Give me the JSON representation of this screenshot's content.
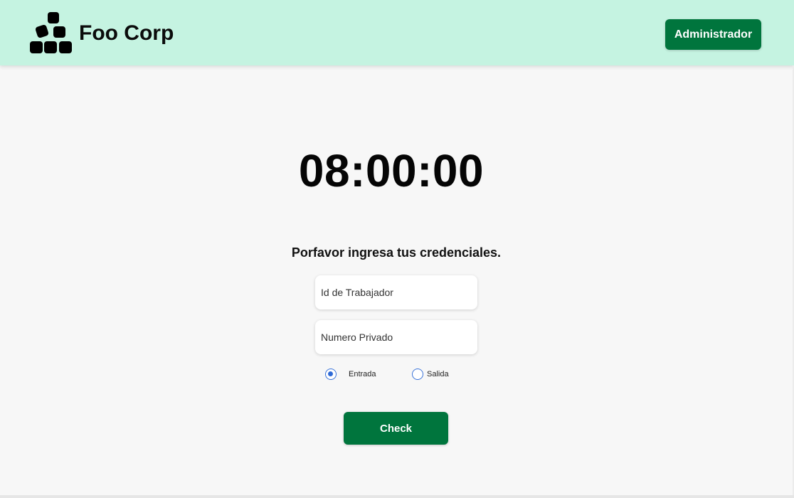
{
  "header": {
    "brand": "Foo Corp",
    "logo_icon": "stacked-blocks-icon",
    "admin_button": "Administrador",
    "background_color": "#c5f3e1",
    "button_color": "#00753d"
  },
  "clock": {
    "time": "08:00:00"
  },
  "form": {
    "prompt": "Porfavor ingresa tus credenciales.",
    "worker_id": {
      "placeholder": "Id de Trabajador",
      "value": ""
    },
    "private_number": {
      "placeholder": "Numero Privado",
      "value": ""
    },
    "options": [
      {
        "label": "Entrada",
        "selected": true
      },
      {
        "label": "Salida",
        "selected": false
      }
    ],
    "submit_button": "Check"
  }
}
